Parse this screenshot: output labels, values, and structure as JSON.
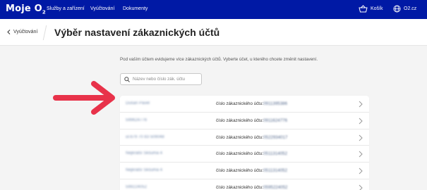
{
  "nav": {
    "logo": "Moje O",
    "logo_sub": "2",
    "links": [
      "Služby a zařízení",
      "Vyúčtování",
      "Dokumenty"
    ],
    "cart_label": "Košík",
    "site_label": "O2.cz"
  },
  "header": {
    "back_label": "Vyúčtování",
    "title": "Výběr nastavení zákaznických účtů"
  },
  "main": {
    "intro": "Pod vaším účtem evidujeme více zákaznických účtů. Vyberte účet, u kterého chcete změnit nastavení.",
    "search_placeholder": "Název nebo číslo zák. účtu",
    "account_prefix": "číslo zákaznického účtu:",
    "accounts": [
      {
        "name": "Dušan Pavel",
        "number": "0911395386"
      },
      {
        "name": "599624776",
        "number": "0911624776"
      },
      {
        "name": "ul.679 70 83 509048",
        "number": "0522934017"
      },
      {
        "name": "Nejkratší Skšuma 4",
        "number": "0511314052"
      },
      {
        "name": "Nejkratší Skšuma 4",
        "number": "0511314052"
      },
      {
        "name": "599224052",
        "number": "0595224052"
      }
    ]
  },
  "colors": {
    "brand": "#0019a5",
    "arrow": "#e8324a"
  }
}
